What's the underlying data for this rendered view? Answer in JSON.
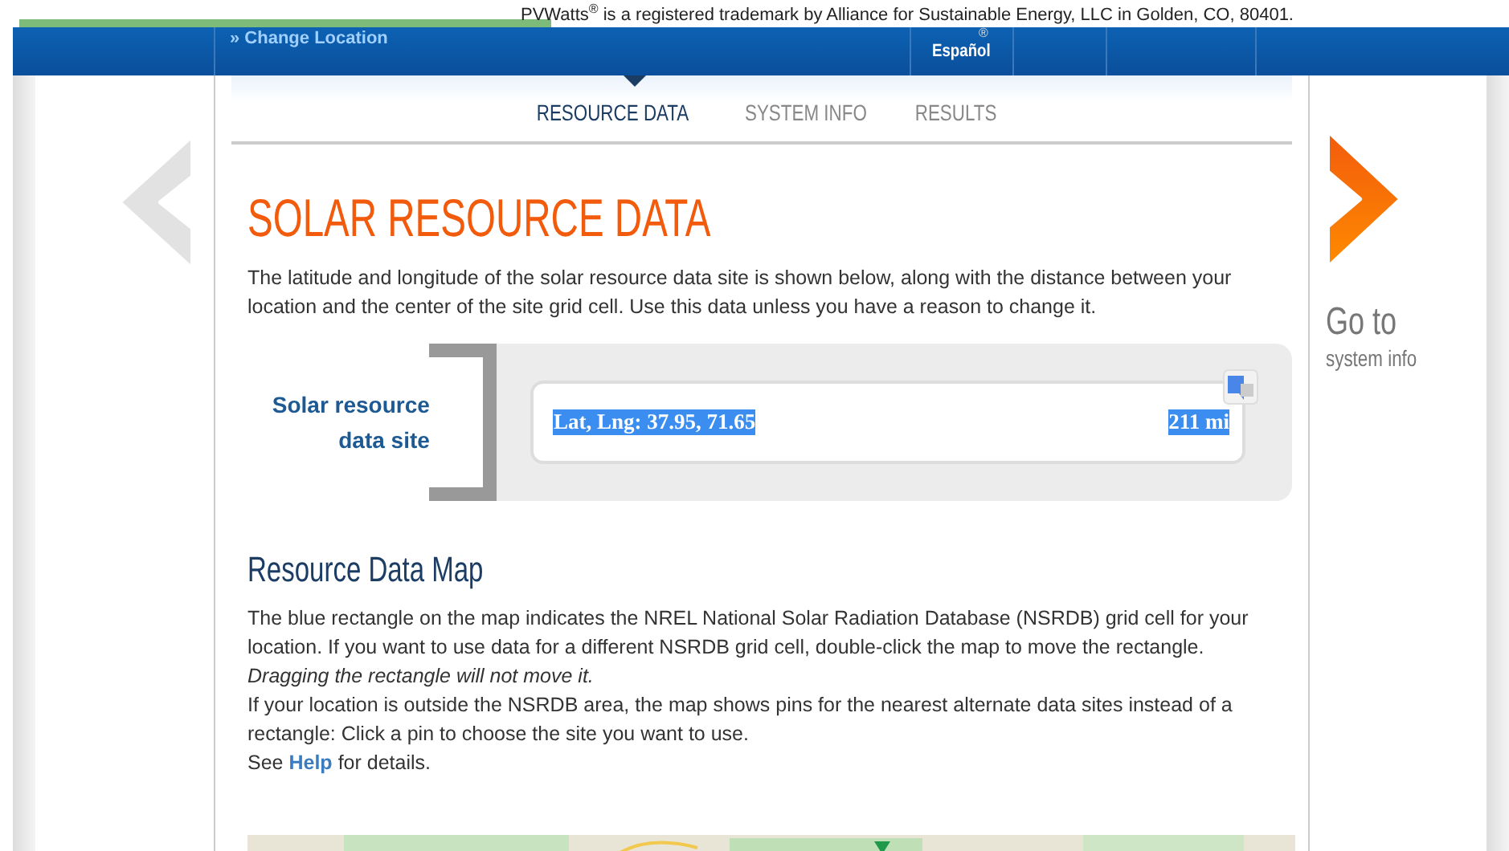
{
  "trademark_notice": "PVWatts$^{®}$ is a registered trademark by Alliance for Sustainable Energy, LLC in Golden, CO, 80401.",
  "header": {
    "change_location": "» Change Location",
    "registered_mark": "®",
    "language": "Español"
  },
  "tabs": [
    {
      "label": "RESOURCE DATA",
      "selected": true
    },
    {
      "label": "SYSTEM INFO",
      "selected": false
    },
    {
      "label": "RESULTS",
      "selected": false
    }
  ],
  "next_step": {
    "line_1": "Go to",
    "line_2": "system info"
  },
  "title": "SOLAR RESOURCE DATA",
  "intro": "The latitude and longitude of the solar resource data site is shown below, along with the distance between your location and the center of the site grid cell. Use this data unless you have a reason to change it.",
  "site": {
    "label": "Solar resource data site",
    "coordinates": "Lat, Lng: 37.95, 71.65",
    "distance": "211 mi",
    "highlighted": true
  },
  "map_heading": "Resource Data Map",
  "map_text": [
    {
      "kind": "plain",
      "text": "The blue rectangle on the map indicates the NREL National Solar Radiation Database (NSRDB) grid cell for your location. If you want to use data for a different NSRDB grid cell, double-click the map to move the rectangle."
    },
    {
      "kind": "italic",
      "text": "Dragging the rectangle will not move it."
    },
    {
      "kind": "plain",
      "text": "If your location is outside the NSRDB area, the map shows pins for the nearest alternate data sites instead of a rectangle: Click a pin to choose the site you want to use."
    },
    {
      "kind": "link",
      "before": "See",
      "link": "Help",
      "after": "for details."
    }
  ]
}
